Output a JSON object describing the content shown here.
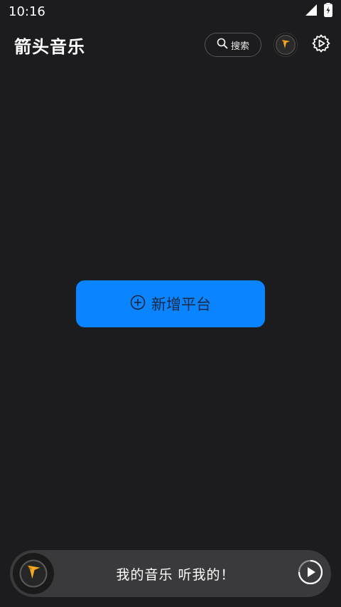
{
  "status_bar": {
    "time": "10:16",
    "icons": [
      "signal-icon",
      "battery-charging-icon"
    ]
  },
  "header": {
    "title": "箭头音乐",
    "search_label": "搜索",
    "icons": [
      "search-icon",
      "avatar-logo-icon",
      "gear-icon"
    ]
  },
  "main": {
    "add_platform_label": "新增平台",
    "add_icon": "plus-circle-icon"
  },
  "player": {
    "slogan": "我的音乐 听我的！",
    "icons": [
      "disc-logo-icon",
      "play-icon"
    ]
  },
  "colors": {
    "background": "#1c1c1e",
    "accent": "#0a84ff",
    "player_bar": "#3a3a3c",
    "logo_orange": "#f5a623"
  }
}
